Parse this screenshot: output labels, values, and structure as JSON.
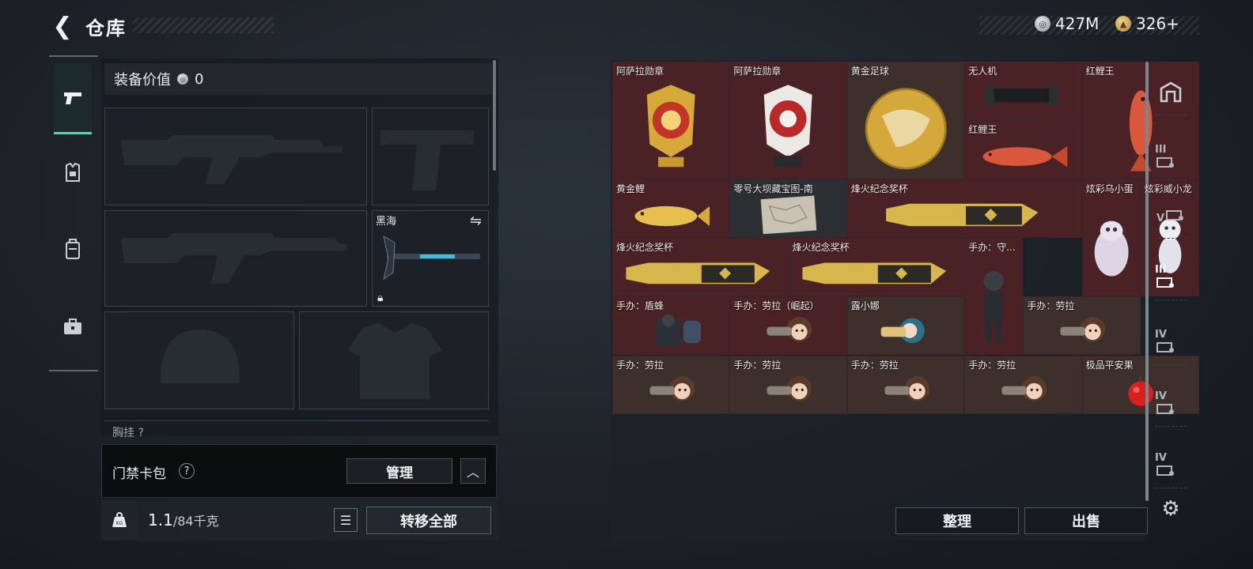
{
  "header": {
    "back_icon": "chevron-left-icon",
    "title": "仓库",
    "currency": [
      {
        "icon": "silver-coin-icon",
        "value": "427M",
        "color": "#c8cdd2"
      },
      {
        "icon": "gold-coin-icon",
        "value": "326+",
        "color": "#d9b56a"
      }
    ]
  },
  "left_rail": {
    "tabs": [
      {
        "icon": "pistol-icon",
        "active": true
      },
      {
        "icon": "armor-icon",
        "active": false
      },
      {
        "icon": "backpack-icon",
        "active": false
      },
      {
        "icon": "toolbox-icon",
        "active": false
      }
    ],
    "accent": "#3fe0b4"
  },
  "equipment": {
    "value_label": "装备价值",
    "value": "0",
    "melee_slot_name": "黑海",
    "chest_rig_label": "胸挂",
    "chest_rig_help": "?"
  },
  "card_pack": {
    "label": "门禁卡包",
    "help": "?",
    "manage": "管理"
  },
  "weight": {
    "icon_text": "KG",
    "current": "1.1",
    "max": "/84千克",
    "transfer_all": "转移全部"
  },
  "storage": {
    "items": [
      {
        "name": "阿萨拉勋章",
        "bg": "red",
        "art": "medal-gold"
      },
      {
        "name": "阿萨拉勋章",
        "bg": "red",
        "art": "medal-red"
      },
      {
        "name": "黄金足球",
        "bg": "brown",
        "art": "ball"
      },
      {
        "name": "无人机",
        "bg": "red",
        "art": "drone"
      },
      {
        "name": "红鲤王",
        "bg": "red",
        "art": "fish-red-v"
      },
      {
        "name": "红鲤王",
        "bg": "red",
        "art": "fish-red"
      },
      {
        "name": "黄金鲤",
        "bg": "red",
        "art": "fish-gold"
      },
      {
        "name": "零号大坝藏宝图-南",
        "bg": "dark",
        "art": "map"
      },
      {
        "name": "烽火纪念奖杯",
        "bg": "red",
        "art": "trophy"
      },
      {
        "name": "炫彩乌小蛋",
        "bg": "red",
        "art": "egg"
      },
      {
        "name": "炫彩威小龙",
        "bg": "red",
        "art": "dragon"
      },
      {
        "name": "烽火纪念奖杯",
        "bg": "red",
        "art": "trophy"
      },
      {
        "name": "烽火纪念奖杯",
        "bg": "red",
        "art": "trophy"
      },
      {
        "name": "手办：守...",
        "bg": "red",
        "art": "figure-dark"
      },
      {
        "name": "手办：盾蜂",
        "bg": "red",
        "art": "figure-shield"
      },
      {
        "name": "手办：劳拉（崛起）",
        "bg": "red",
        "art": "figure-laura"
      },
      {
        "name": "露小娜",
        "bg": "brown",
        "art": "figure-luna"
      },
      {
        "name": "手办：劳拉",
        "bg": "brown",
        "art": "figure-laura"
      },
      {
        "name": "手办：劳拉",
        "bg": "brown",
        "art": "figure-laura"
      },
      {
        "name": "手办：劳拉",
        "bg": "brown",
        "art": "figure-laura"
      },
      {
        "name": "手办：劳拉",
        "bg": "brown",
        "art": "figure-laura"
      },
      {
        "name": "手办：劳拉",
        "bg": "brown",
        "art": "figure-laura"
      },
      {
        "name": "极品平安果",
        "bg": "brown",
        "art": "apple"
      }
    ],
    "sort": "整理",
    "sell": "出售"
  },
  "right_rail": {
    "tabs": [
      {
        "icon": "safe-box-icon",
        "label": ""
      },
      {
        "icon": "stash-3-icon",
        "label": "III"
      },
      {
        "icon": "stash-5-icon",
        "label": "V"
      },
      {
        "icon": "stash-3b-icon",
        "label": "III",
        "active": true
      },
      {
        "icon": "stash-4-icon",
        "label": "IV"
      },
      {
        "icon": "stash-4b-icon",
        "label": "IV"
      },
      {
        "icon": "stash-4c-icon",
        "label": "IV"
      }
    ],
    "settings_icon": "gear-icon"
  }
}
